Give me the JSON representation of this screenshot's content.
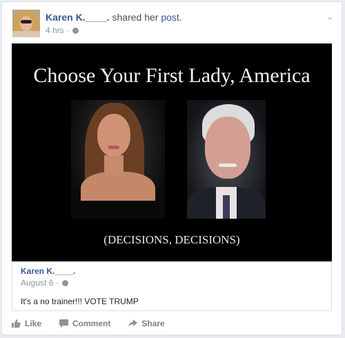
{
  "post": {
    "author": "Karen K.____.",
    "action_text": "shared her",
    "link_text": "post.",
    "time": "4 hrs ·"
  },
  "image": {
    "title": "Choose Your First Lady, America",
    "caption": "(DECISIONS, DECISIONS)"
  },
  "original": {
    "author": "Karen K.____.",
    "date": "August 6 ·",
    "text": "It's a no trainer!!! VOTE TRUMP"
  },
  "actions": {
    "like": "Like",
    "comment": "Comment",
    "share": "Share"
  },
  "icons": {
    "globe": "globe-icon",
    "menu": "chevron-down-icon",
    "like": "thumbs-up-icon",
    "comment": "speech-bubble-icon",
    "share": "share-arrow-icon"
  },
  "colors": {
    "link": "#365899",
    "muted": "#90949c",
    "background": "#e9ebee"
  }
}
